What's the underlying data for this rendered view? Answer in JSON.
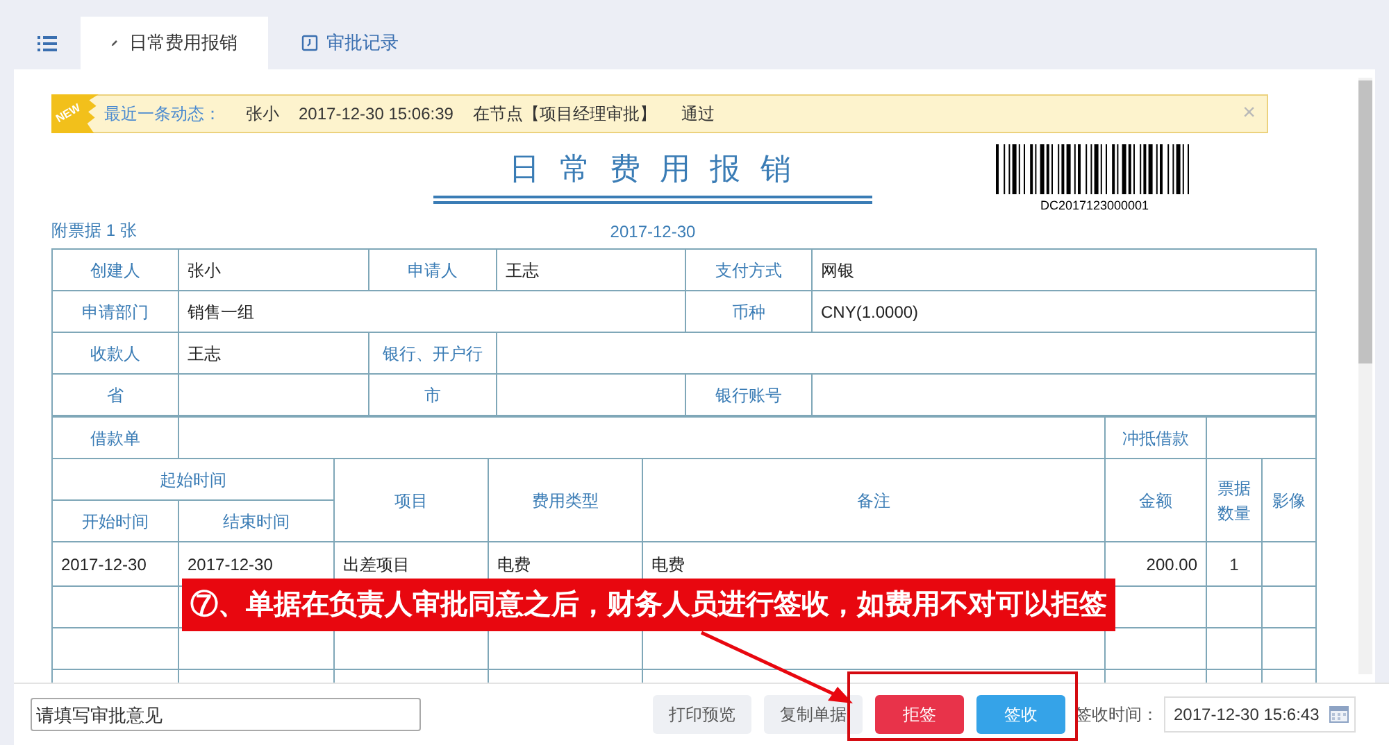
{
  "tabs": [
    {
      "label": "日常费用报销",
      "selected": true
    },
    {
      "label": "审批记录",
      "selected": false
    }
  ],
  "notice": {
    "badge": "NEW",
    "label": "最近一条动态：",
    "user": "张小",
    "time": "2017-12-30 15:06:39",
    "node": "在节点【项目经理审批】",
    "result": "通过",
    "close": "×"
  },
  "form": {
    "title": "日 常 费 用 报 销",
    "date": "2017-12-30",
    "barcode_number": "DC2017123000001",
    "attachments": "附票据 1 张",
    "info_rows": [
      [
        {
          "label": "创建人",
          "value": "张小"
        },
        {
          "label": "申请人",
          "value": "王志"
        },
        {
          "label": "支付方式",
          "value": "网银"
        }
      ],
      [
        {
          "label": "申请部门",
          "value": "销售一组",
          "kind": "wide"
        },
        {
          "label": "币种",
          "value": "CNY(1.0000)"
        }
      ],
      [
        {
          "label": "收款人",
          "value": "王志"
        },
        {
          "label": "银行、开户行"
        }
      ],
      [
        {
          "label": "省"
        },
        {
          "label": "市"
        },
        {
          "label": "银行账号"
        }
      ]
    ],
    "loan": {
      "label": "借款单",
      "offset_label": "冲抵借款"
    },
    "columns": {
      "period": "起始时间",
      "start": "开始时间",
      "end": "结束时间",
      "project": "项目",
      "type": "费用类型",
      "note": "备注",
      "amount": "金额",
      "count": "票据数量",
      "image": "影像"
    },
    "rows": [
      {
        "start": "2017-12-30",
        "end": "2017-12-30",
        "project": "出差项目",
        "type": "电费",
        "note": "电费",
        "amount": "200.00",
        "count": "1"
      }
    ]
  },
  "annotation": "⑦、单据在负责人审批同意之后，财务人员进行签收，如费用不对可以拒签",
  "bottom": {
    "opinion_placeholder": "请填写审批意见",
    "buttons": [
      {
        "label": "打印预览",
        "kind": "plain"
      },
      {
        "label": "复制单据",
        "kind": "plain"
      },
      {
        "label": "拒签",
        "kind": "danger"
      },
      {
        "label": "签收",
        "kind": "primary"
      }
    ],
    "sign_label": "签收时间：",
    "sign_time": "2017-12-30 15:6:43"
  }
}
